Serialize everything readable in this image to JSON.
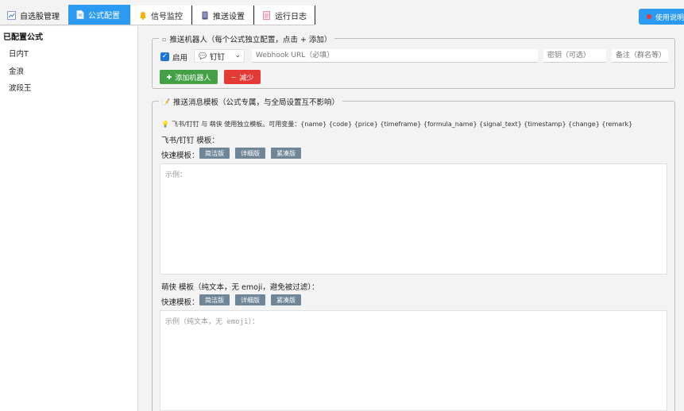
{
  "tabs": [
    {
      "label": "自选股管理",
      "icon": "chart-icon"
    },
    {
      "label": "公式配置",
      "icon": "document-icon",
      "active": true
    },
    {
      "label": "信号监控",
      "icon": "bell-icon"
    },
    {
      "label": "推送设置",
      "icon": "phone-icon"
    },
    {
      "label": "运行日志",
      "icon": "log-icon"
    }
  ],
  "help_button": {
    "label": "使用说明"
  },
  "sidebar": {
    "title": "已配置公式",
    "items": [
      {
        "label": "日内T"
      },
      {
        "label": "金浪"
      },
      {
        "label": "波段王"
      }
    ]
  },
  "robot_section": {
    "legend": "推送机器人（每个公式独立配置，点击 + 添加）",
    "enabled_label": "启用",
    "enabled": true,
    "channel_value": "钉钉",
    "webhook_placeholder": "Webhook URL（必填）",
    "secret_placeholder": "密钥（可选）",
    "remark_placeholder": "备注（群名等）",
    "add_button": "添加机器人",
    "remove_button": "减少"
  },
  "template_section": {
    "legend": "推送消息模板（公式专属，与全局设置互不影响）",
    "hint": "飞书/钉钉 与 萌侠 使用独立模板。可用变量：{name} {code} {price} {timeframe} {formula_name} {signal_text} {timestamp} {change} {remark}",
    "feishu_label": "飞书/钉钉 模板：",
    "quick_label_1": "快速模板：",
    "quick_buttons_1": [
      "简洁版",
      "详细版",
      "紧凑版"
    ],
    "feishu_placeholder": "示例：",
    "mengxia_label": "萌侠 模板（纯文本，无 emoji，避免被过滤）：",
    "quick_label_2": "快速模板：",
    "quick_buttons_2": [
      "简洁版",
      "详细版",
      "紧凑版"
    ],
    "mengxia_placeholder": "示例（纯文本，无 emoji）："
  },
  "colors": {
    "accent": "#2b9af3",
    "green": "#43a047",
    "red": "#e53935",
    "quick_button": "#6f8698",
    "checkbox": "#1e73d8"
  }
}
